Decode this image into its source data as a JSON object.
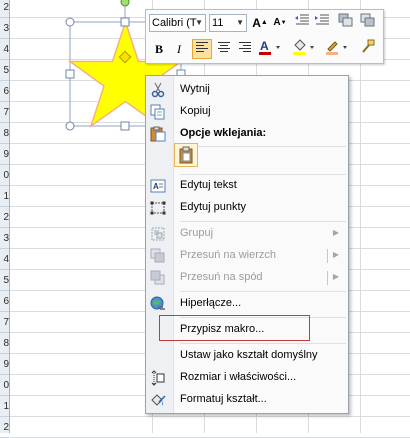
{
  "row_numbers": [
    "2",
    "3",
    "4",
    "5",
    "6",
    "7",
    "8",
    "9",
    "0",
    "1",
    "2",
    "3",
    "4",
    "5",
    "6",
    "7",
    "8",
    "9",
    "0",
    "1",
    "2"
  ],
  "toolbar": {
    "font_name": "Calibri (T",
    "font_size": "11",
    "bold": "B",
    "italic": "I",
    "underline_color": "#c00000",
    "highlight_color": "#ffff00"
  },
  "menu": {
    "cut": "Wytnij",
    "copy": "Kopiuj",
    "paste_options": "Opcje wklejania:",
    "edit_text": "Edytuj tekst",
    "edit_points": "Edytuj punkty",
    "group": "Grupuj",
    "bring_front": "Przesuń na wierzch",
    "send_back": "Przesuń na spód",
    "hyperlink": "Hiperłącze...",
    "assign_macro": "Przypisz makro...",
    "set_default": "Ustaw jako kształt domyślny",
    "size_props": "Rozmiar i właściwości...",
    "format_shape": "Formatuj kształt..."
  },
  "shape": {
    "fill_color": "#ffff00",
    "outline_color": "#f4b183"
  }
}
